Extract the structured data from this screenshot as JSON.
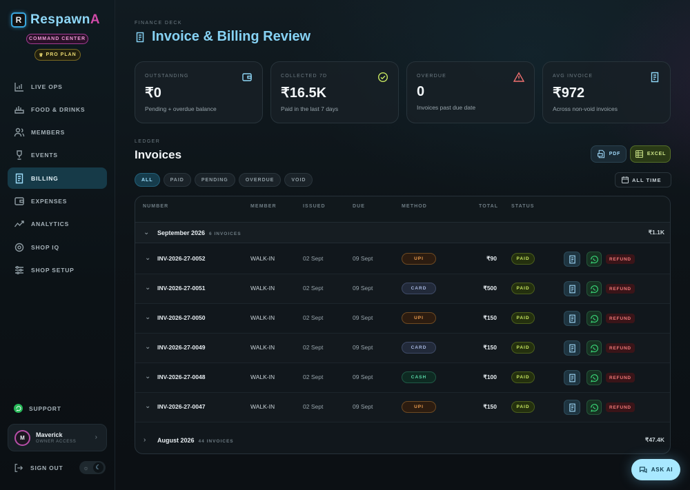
{
  "brand": {
    "name_main": "Respawn",
    "name_accent": "A",
    "logo_letter": "R",
    "command_badge": "COMMAND CENTER",
    "plan_badge": "PRO PLAN"
  },
  "sidebar": {
    "items": [
      {
        "label": "LIVE OPS",
        "icon": "chart-icon",
        "active": false
      },
      {
        "label": "FOOD & DRINKS",
        "icon": "food-icon",
        "active": false
      },
      {
        "label": "MEMBERS",
        "icon": "users-icon",
        "active": false
      },
      {
        "label": "EVENTS",
        "icon": "trophy-icon",
        "active": false
      },
      {
        "label": "BILLING",
        "icon": "receipt-icon",
        "active": true
      },
      {
        "label": "EXPENSES",
        "icon": "wallet-icon",
        "active": false
      },
      {
        "label": "ANALYTICS",
        "icon": "trend-icon",
        "active": false
      },
      {
        "label": "SHOP IQ",
        "icon": "brain-icon",
        "active": false
      },
      {
        "label": "SHOP SETUP",
        "icon": "sliders-icon",
        "active": false
      }
    ],
    "support_label": "SUPPORT",
    "user": {
      "initial": "M",
      "name": "Maverick",
      "role": "OWNER ACCESS"
    },
    "signout_label": "SIGN OUT"
  },
  "header": {
    "eyebrow": "FINANCE DECK",
    "title": "Invoice & Billing Review"
  },
  "stats": [
    {
      "label": "OUTSTANDING",
      "value": "₹0",
      "sub": "Pending + overdue balance",
      "icon": "wallet-icon",
      "icon_color": "#8fd8f8"
    },
    {
      "label": "COLLECTED 7D",
      "value": "₹16.5K",
      "sub": "Paid in the last 7 days",
      "icon": "check-circle-icon",
      "icon_color": "#c8e860"
    },
    {
      "label": "OVERDUE",
      "value": "0",
      "sub": "Invoices past due date",
      "icon": "warning-icon",
      "icon_color": "#f07070"
    },
    {
      "label": "AVG INVOICE",
      "value": "₹972",
      "sub": "Across non-void invoices",
      "icon": "receipt-icon",
      "icon_color": "#8fd8f8"
    }
  ],
  "ledger": {
    "eyebrow": "LEDGER",
    "title": "Invoices",
    "export_pdf": "PDF",
    "export_excel": "EXCEL",
    "filters": [
      "ALL",
      "PAID",
      "PENDING",
      "OVERDUE",
      "VOID"
    ],
    "active_filter": "ALL",
    "date_range": "ALL TIME"
  },
  "table": {
    "columns": [
      "NUMBER",
      "MEMBER",
      "ISSUED",
      "DUE",
      "METHOD",
      "TOTAL",
      "STATUS"
    ],
    "groups": [
      {
        "title": "September 2026",
        "count": "6 INVOICES",
        "total": "₹1.1K",
        "expanded": true
      },
      {
        "title": "August 2026",
        "count": "44 INVOICES",
        "total": "₹47.4K",
        "expanded": false
      }
    ],
    "rows": [
      {
        "number": "INV-2026-27-0052",
        "member": "WALK-IN",
        "issued": "02 Sept",
        "due": "09 Sept",
        "method": "UPI",
        "total": "₹90",
        "status": "PAID",
        "refund": "REFUND"
      },
      {
        "number": "INV-2026-27-0051",
        "member": "WALK-IN",
        "issued": "02 Sept",
        "due": "09 Sept",
        "method": "CARD",
        "total": "₹500",
        "status": "PAID",
        "refund": "REFUND"
      },
      {
        "number": "INV-2026-27-0050",
        "member": "WALK-IN",
        "issued": "02 Sept",
        "due": "09 Sept",
        "method": "UPI",
        "total": "₹150",
        "status": "PAID",
        "refund": "REFUND"
      },
      {
        "number": "INV-2026-27-0049",
        "member": "WALK-IN",
        "issued": "02 Sept",
        "due": "09 Sept",
        "method": "CARD",
        "total": "₹150",
        "status": "PAID",
        "refund": "REFUND"
      },
      {
        "number": "INV-2026-27-0048",
        "member": "WALK-IN",
        "issued": "02 Sept",
        "due": "09 Sept",
        "method": "CASH",
        "total": "₹100",
        "status": "PAID",
        "refund": "REFUND"
      },
      {
        "number": "INV-2026-27-0047",
        "member": "WALK-IN",
        "issued": "02 Sept",
        "due": "09 Sept",
        "method": "UPI",
        "total": "₹150",
        "status": "PAID",
        "refund": "REFUND"
      }
    ]
  },
  "ask_ai_label": "ASK AI"
}
